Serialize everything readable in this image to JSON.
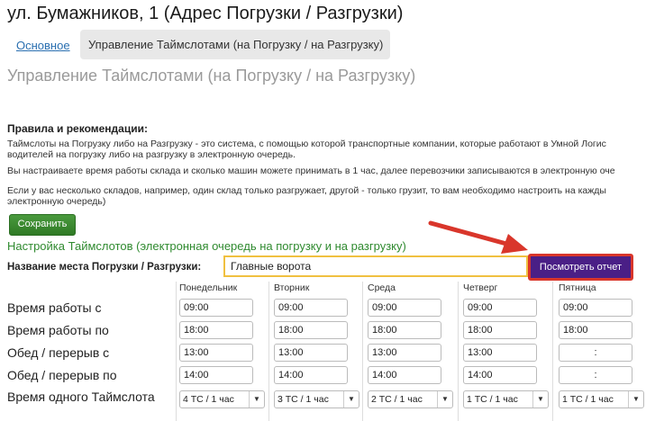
{
  "header": {
    "title": "ул. Бумажников, 1 (Адрес Погрузки / Разгрузки)"
  },
  "tabs": [
    {
      "label": "Основное"
    },
    {
      "label": "Управление Таймслотами (на Погрузку / на Разгрузку)"
    }
  ],
  "page_heading": "Управление Таймслотами (на Погрузку / на Разгрузку)",
  "rules": {
    "title": "Правила и рекомендации:",
    "lines": [
      "Таймслоты на Погрузку либо на Разгрузку - это система, с помощью которой транспортные компании, которые работают в Умной Логис",
      "водителей на погрузку либо на разгрузку в электронную очередь.",
      "Вы настраиваете время работы склада и сколько машин можете принимать в 1 час, далее перевозчики записываются в электронную оче",
      "Если у вас несколько складов, например, один склад только разгружает, другой - только грузит, то вам необходимо настроить на кажды",
      "электронную очередь)"
    ]
  },
  "save_label": "Сохранить",
  "settings_title": "Настройка Таймслотов (электронная очередь на погрузку и на разгрузку)",
  "place_label": "Название места Погрузки / Разгрузки:",
  "place_value": "Главные ворота",
  "report_label": "Посмотреть отчет",
  "days": [
    "Понедельник",
    "Вторник",
    "Среда",
    "Четверг",
    "Пятница"
  ],
  "row_labels": [
    "Время работы с",
    "Время работы по",
    "Обед / перерыв с",
    "Обед / перерыв по",
    "Время одного Таймслота"
  ],
  "grid": [
    [
      "09:00",
      "09:00",
      "09:00",
      "09:00",
      "09:00"
    ],
    [
      "18:00",
      "18:00",
      "18:00",
      "18:00",
      "18:00"
    ],
    [
      "13:00",
      "13:00",
      "13:00",
      "13:00",
      ":"
    ],
    [
      "14:00",
      "14:00",
      "14:00",
      "14:00",
      ":"
    ]
  ],
  "slots": [
    "4 ТС / 1 час",
    "3 ТС / 1 час",
    "2 ТС / 1 час",
    "1 ТС / 1 час",
    "1 ТС / 1 час"
  ],
  "colors": {
    "accent_green": "#2f8a2f",
    "report_button": "#4a1f86",
    "highlight_red": "#d9362b",
    "input_highlight": "#f0c040"
  }
}
